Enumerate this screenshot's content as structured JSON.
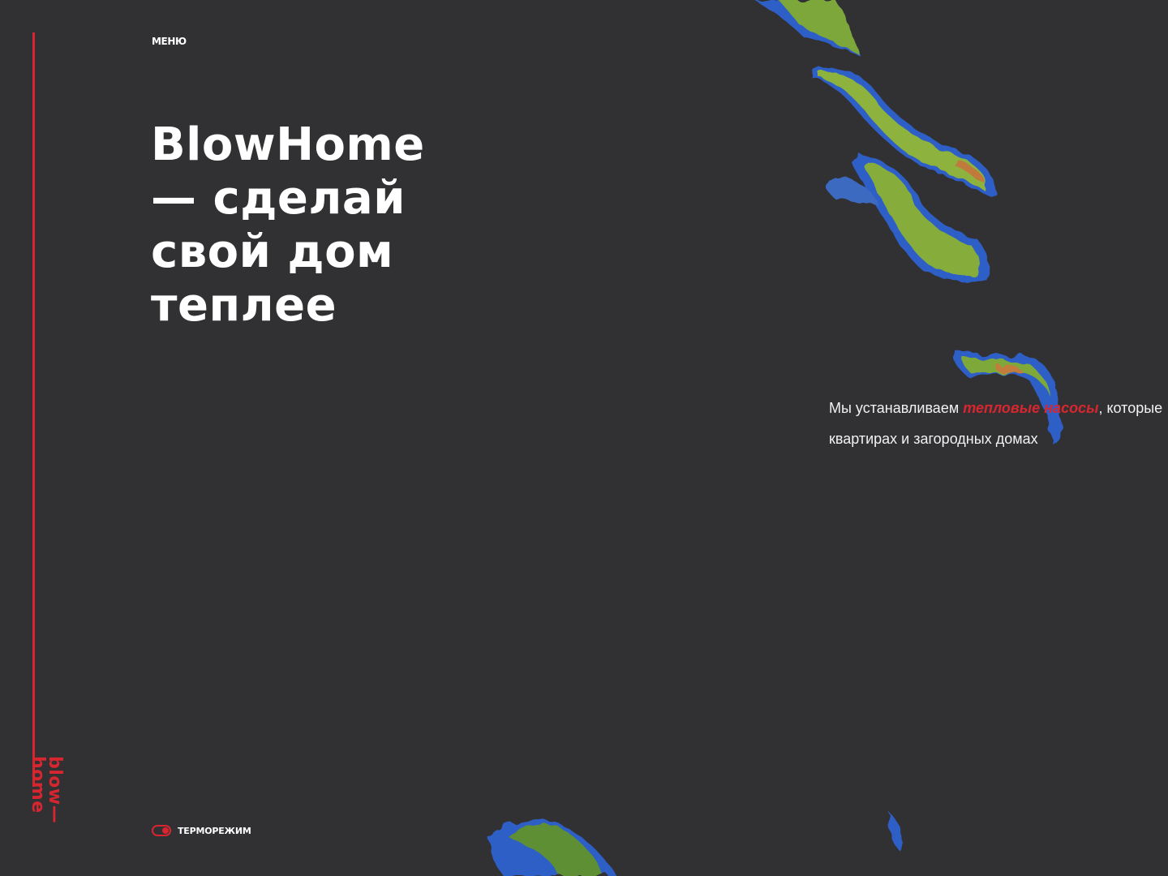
{
  "brand": {
    "logo_line1": "blow—",
    "logo_line2": "home"
  },
  "nav": {
    "menu_label": "МЕНЮ"
  },
  "hero": {
    "title_line1": "BlowHome",
    "title_line2": "— сделай",
    "title_line3": "свой дом",
    "title_line4": "теплее"
  },
  "description": {
    "before": "Мы устанавливаем ",
    "highlight": "тепловые насосы",
    "after": ", которые",
    "line2": "квартирах и загородных домах"
  },
  "thermo_mode": {
    "label": "ТЕРМОРЕЖИМ",
    "enabled": true
  },
  "colors": {
    "background": "#313134",
    "accent": "#d7262f",
    "text": "#ffffff"
  },
  "illustration": {
    "icon": "thermal-portrait"
  }
}
